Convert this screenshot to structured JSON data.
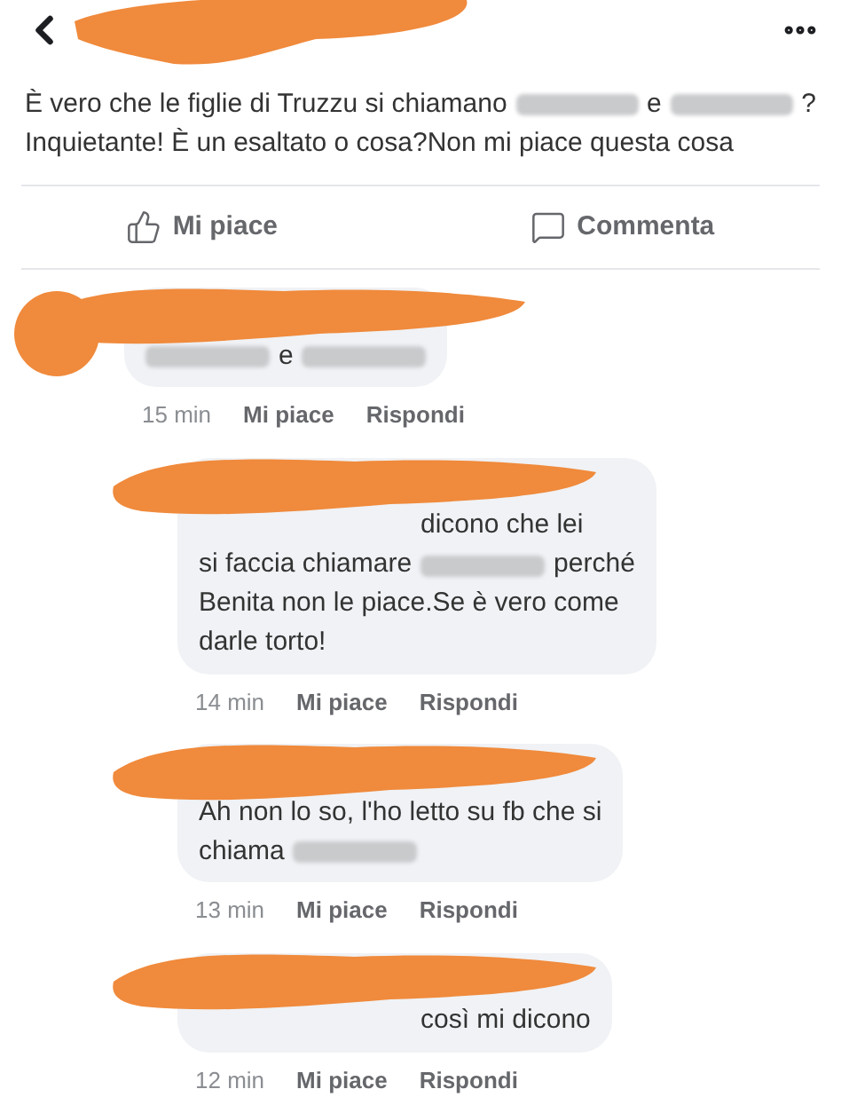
{
  "post": {
    "lines": [
      [
        {
          "kind": "text",
          "text": "È vero che le figlie di Truzzu si chiamano"
        },
        {
          "kind": "blur"
        },
        {
          "kind": "text",
          "text": "e"
        },
        {
          "kind": "blur"
        },
        {
          "kind": "text",
          "text": "?"
        }
      ],
      [
        {
          "kind": "text",
          "text": "Inquietante! È un esaltato o cosa?Non mi piace questa cosa"
        }
      ]
    ]
  },
  "actions": [
    {
      "kind": "like",
      "label": "Mi piace"
    },
    {
      "kind": "comment",
      "label": "Commenta"
    }
  ],
  "comments": [
    {
      "kind": "comment",
      "lines": [
        [
          {
            "kind": "hidden"
          }
        ],
        [
          {
            "kind": "blur"
          },
          {
            "kind": "text",
            "text": "e"
          },
          {
            "kind": "blur"
          }
        ]
      ],
      "time": "15 min",
      "like": "Mi piace",
      "reply": "Rispondi"
    },
    {
      "kind": "reply",
      "lines": [
        [
          {
            "kind": "hidden"
          }
        ],
        [
          {
            "kind": "hidden"
          },
          {
            "kind": "text",
            "text": "dicono che lei"
          }
        ],
        [
          {
            "kind": "text",
            "text": "si faccia chiamare"
          },
          {
            "kind": "blur"
          },
          {
            "kind": "text",
            "text": "perché"
          }
        ],
        [
          {
            "kind": "text",
            "text": "Benita non le piace.Se è vero come"
          }
        ],
        [
          {
            "kind": "text",
            "text": "darle torto!"
          }
        ]
      ],
      "time": "14 min",
      "like": "Mi piace",
      "reply": "Rispondi"
    },
    {
      "kind": "reply",
      "lines": [
        [
          {
            "kind": "hidden"
          }
        ],
        [
          {
            "kind": "text",
            "text": "Ah non lo so, l'ho letto su fb che si"
          }
        ],
        [
          {
            "kind": "text",
            "text": "chiama"
          },
          {
            "kind": "blur"
          }
        ]
      ],
      "time": "13 min",
      "like": "Mi piace",
      "reply": "Rispondi"
    },
    {
      "kind": "reply",
      "lines": [
        [
          {
            "kind": "hidden"
          }
        ],
        [
          {
            "kind": "hidden"
          },
          {
            "kind": "text",
            "text": "così mi dicono"
          }
        ]
      ],
      "time": "12 min",
      "like": "Mi piace",
      "reply": "Rispondi"
    }
  ]
}
